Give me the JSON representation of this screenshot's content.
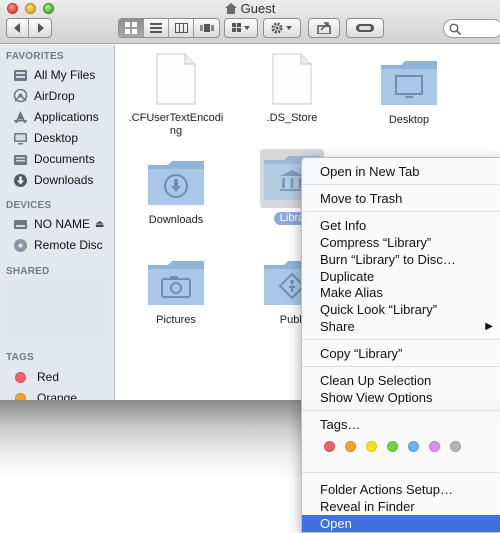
{
  "window": {
    "title": "Guest"
  },
  "toolbar": {
    "back_icon": "chevron-left-icon",
    "forward_icon": "chevron-right-icon",
    "view_icons": [
      "icon-view-icon",
      "list-view-icon",
      "column-view-icon",
      "coverflow-view-icon"
    ],
    "arrange_icon": "grid-arrange-icon",
    "action_icon": "gear-icon",
    "share_icon": "share-icon",
    "tags_icon": "tag-pill-icon",
    "search_icon": "search-icon"
  },
  "sidebar": {
    "favorites_header": "FAVORITES",
    "favorites": [
      {
        "label": "All My Files",
        "icon": "all-files-icon"
      },
      {
        "label": "AirDrop",
        "icon": "airdrop-icon"
      },
      {
        "label": "Applications",
        "icon": "applications-icon"
      },
      {
        "label": "Desktop",
        "icon": "desktop-icon"
      },
      {
        "label": "Documents",
        "icon": "documents-icon"
      },
      {
        "label": "Downloads",
        "icon": "downloads-icon"
      }
    ],
    "devices_header": "DEVICES",
    "devices": [
      {
        "label": "NO NAME",
        "icon": "drive-icon"
      },
      {
        "label": "Remote Disc",
        "icon": "disc-icon"
      }
    ],
    "shared_header": "SHARED",
    "tags_header": "TAGS",
    "tags": [
      {
        "label": "Red",
        "color": "#f0616d"
      },
      {
        "label": "Orange",
        "color": "#f7a12f"
      }
    ]
  },
  "files": [
    {
      "name": ".CFUserTextEncoding",
      "line1": ".CFUserTextEncodi",
      "line2": "ng",
      "kind": "document"
    },
    {
      "name": ".DS_Store",
      "kind": "document"
    },
    {
      "name": "Desktop",
      "kind": "folder"
    },
    {
      "name": "Downloads",
      "kind": "folder"
    },
    {
      "name": "Library",
      "label_visible": "Libra",
      "kind": "folder",
      "selected": true
    },
    {
      "name": "Pictures",
      "kind": "folder"
    },
    {
      "name": "Public",
      "label_visible": "Publi",
      "kind": "folder"
    }
  ],
  "context_menu": {
    "items": [
      "Open in New Tab",
      "Move to Trash",
      "Get Info",
      "Compress “Library”",
      "Burn “Library” to Disc…",
      "Duplicate",
      "Make Alias",
      "Quick Look “Library”",
      "Share",
      "Copy “Library”",
      "Clean Up Selection",
      "Show View Options",
      "Tags…",
      "Folder Actions Setup…",
      "Reveal in Finder",
      "Open"
    ],
    "highlighted": "Open",
    "tag_colors": [
      "#f0616d",
      "#f7a12f",
      "#f5e41c",
      "#71d33e",
      "#6cb4f0",
      "#dc8ef0",
      "#b5b5b5"
    ]
  }
}
